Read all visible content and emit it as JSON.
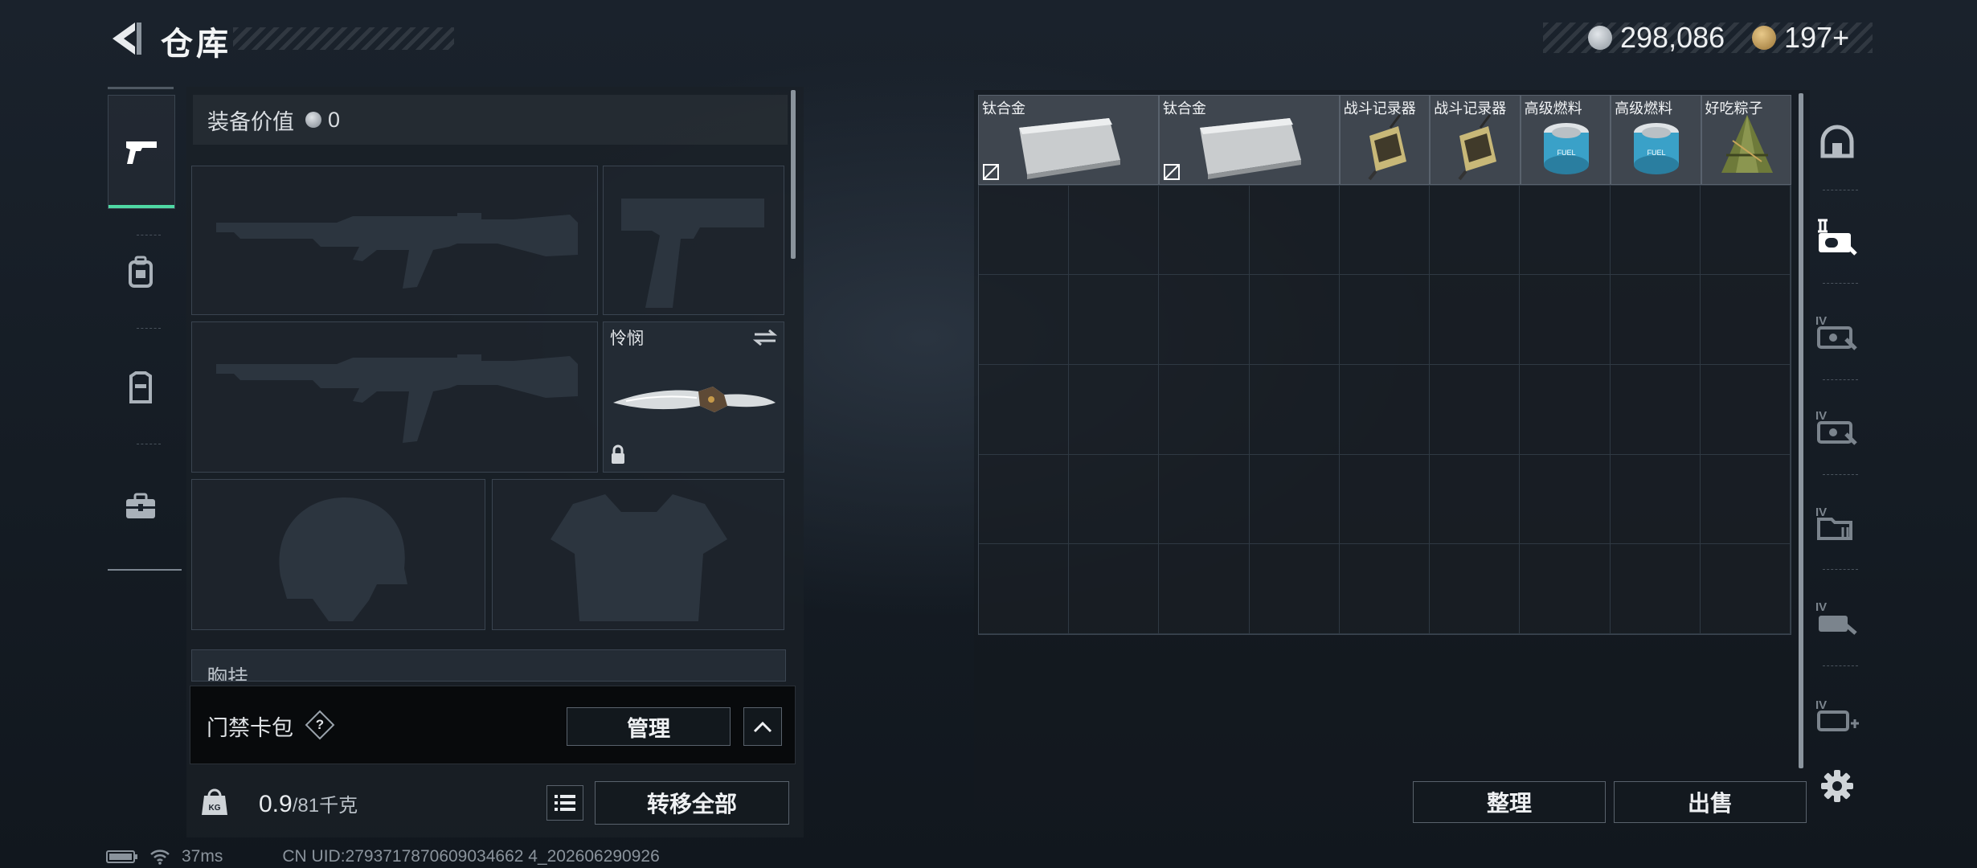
{
  "header": {
    "title": "仓库"
  },
  "currency": [
    {
      "value": "298,086",
      "icon": "silver-coin-icon",
      "color": "#b9bfc5"
    },
    {
      "value": "197+",
      "icon": "gold-triangle-coin-icon",
      "color": "#c49a5a"
    }
  ],
  "nav": [
    {
      "icon": "pistol-icon",
      "active": true
    },
    {
      "icon": "backpack-icon"
    },
    {
      "icon": "vest-icon"
    },
    {
      "icon": "toolbox-icon"
    }
  ],
  "loadout": {
    "value_label": "装备价值",
    "value": "0",
    "melee_slot": {
      "name": "怜悯"
    },
    "chest_label": "胸挂",
    "card_bag": {
      "label": "门禁卡包",
      "help": "?",
      "manage_label": "管理"
    },
    "weight": {
      "current": "0.9",
      "max_unit": "/81千克"
    },
    "transfer_all_label": "转移全部"
  },
  "storage": {
    "columns": 9,
    "rows": 6,
    "items": [
      {
        "name": "钛合金",
        "kind": "metal-plate",
        "col": 1,
        "span": 2,
        "marked": true
      },
      {
        "name": "钛合金",
        "kind": "metal-plate",
        "col": 3,
        "span": 2,
        "marked": true
      },
      {
        "name": "战斗记录器",
        "kind": "recorder",
        "col": 5,
        "span": 1
      },
      {
        "name": "战斗记录器",
        "kind": "recorder",
        "col": 6,
        "span": 1
      },
      {
        "name": "高级燃料",
        "kind": "fuel-can",
        "col": 7,
        "span": 1
      },
      {
        "name": "高级燃料",
        "kind": "fuel-can",
        "col": 8,
        "span": 1
      },
      {
        "name": "好吃粽子",
        "kind": "zongzi",
        "col": 9,
        "span": 1
      }
    ],
    "sort_label": "整理",
    "sell_label": "出售"
  },
  "rail": [
    {
      "icon": "safe-box-icon"
    },
    {
      "icon": "storage-ii-icon"
    },
    {
      "icon": "storage-iv-a-icon"
    },
    {
      "icon": "storage-iv-b-icon"
    },
    {
      "icon": "storage-iv-c-icon"
    },
    {
      "icon": "storage-iv-d-icon"
    },
    {
      "icon": "storage-iv-add-icon"
    }
  ],
  "status": {
    "ping": "37ms",
    "uid": "CN UID:2793717870609034662 4_202606290926"
  }
}
